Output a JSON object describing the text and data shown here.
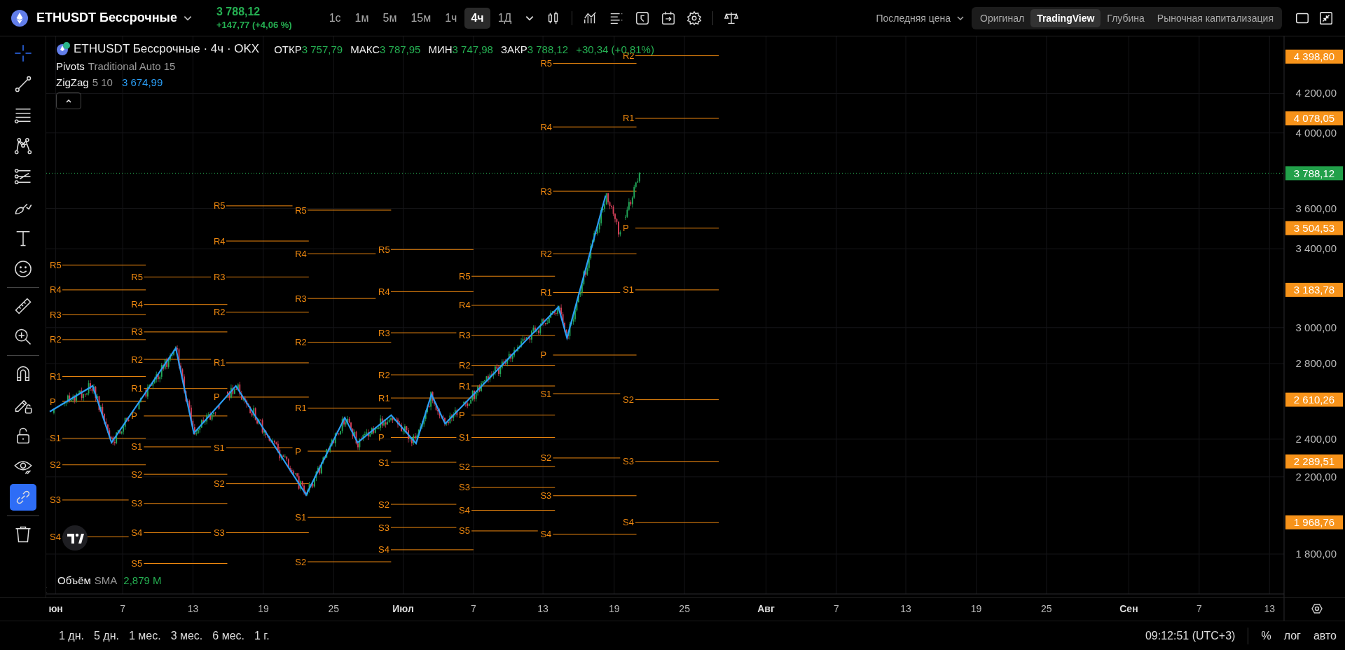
{
  "header": {
    "symbol": "ETHUSDT Бессрочные",
    "price": "3 788,12",
    "change": "+147,77 (+4,06 %)",
    "intervals": [
      {
        "label": "1с",
        "selected": false
      },
      {
        "label": "1м",
        "selected": false
      },
      {
        "label": "5м",
        "selected": false
      },
      {
        "label": "15м",
        "selected": false
      },
      {
        "label": "1ч",
        "selected": false
      },
      {
        "label": "4ч",
        "selected": true
      },
      {
        "label": "1Д",
        "selected": false
      }
    ],
    "price_source": "Последняя цена",
    "views": [
      {
        "label": "Оригинал",
        "selected": false
      },
      {
        "label": "TradingView",
        "selected": true
      },
      {
        "label": "Глубина",
        "selected": false
      },
      {
        "label": "Рыночная капитализация",
        "selected": false
      }
    ]
  },
  "tool_groups": [
    [
      {
        "kind": "crosshair",
        "selected": true,
        "on": false
      },
      {
        "kind": "line",
        "selected": false,
        "on": false
      },
      {
        "kind": "hlines",
        "selected": false,
        "on": false
      },
      {
        "kind": "pattern",
        "selected": false,
        "on": false
      },
      {
        "kind": "fib",
        "selected": false,
        "on": false
      },
      {
        "kind": "brush",
        "selected": false,
        "on": false
      },
      {
        "kind": "text",
        "selected": false,
        "on": false
      },
      {
        "kind": "smiley",
        "selected": false,
        "on": false
      }
    ],
    [
      {
        "kind": "ruler",
        "selected": false,
        "on": false
      },
      {
        "kind": "zoom",
        "selected": false,
        "on": false
      }
    ],
    [
      {
        "kind": "magnet",
        "selected": false,
        "on": false
      },
      {
        "kind": "pencil-lock",
        "selected": false,
        "on": false
      },
      {
        "kind": "lock",
        "selected": false,
        "on": false
      },
      {
        "kind": "eye",
        "selected": false,
        "on": false
      },
      {
        "kind": "link",
        "selected": false,
        "on": true
      }
    ],
    [
      {
        "kind": "trash",
        "selected": false,
        "on": false
      }
    ]
  ],
  "legend": {
    "title": "ETHUSDT Бессрочные · 4ч · OKX",
    "ohlc": [
      {
        "label": "ОТКР",
        "value": "3 757,79"
      },
      {
        "label": "МАКС",
        "value": "3 787,95"
      },
      {
        "label": "МИН",
        "value": "3 747,98"
      },
      {
        "label": "ЗАКР",
        "value": "3 788,12"
      }
    ],
    "change": "+30,34 (+0,81%)",
    "indicators": [
      {
        "name": "Pivots",
        "params": "Traditional Auto 15"
      },
      {
        "name": "ZigZag",
        "params": "5 10",
        "value": "3 674,99"
      }
    ]
  },
  "pivots": [
    {
      "labels": [
        "R5",
        "R4",
        "R3",
        "R2",
        "R1",
        "P",
        "S1",
        "S2",
        "S3",
        "S4"
      ]
    },
    {
      "labels": [
        "R5",
        "R4",
        "R3",
        "R2",
        "R1",
        "P",
        "S1",
        "S2",
        "S3",
        "S4",
        "S5"
      ]
    },
    {
      "labels": [
        "R5",
        "R4",
        "R3",
        "R2",
        "R1",
        "P",
        "S1",
        "S2",
        "S3"
      ]
    },
    {
      "labels": [
        "R5",
        "R4",
        "R3",
        "R2",
        "R1",
        "P",
        "S1",
        "S2"
      ]
    },
    {
      "labels": [
        "R5",
        "R4",
        "R3",
        "R2",
        "R1",
        "P",
        "S1",
        "S2",
        "S3",
        "S4"
      ]
    },
    {
      "labels": [
        "R5",
        "R4",
        "R3",
        "R2",
        "R1",
        "P",
        "S1",
        "S2",
        "S3",
        "S4",
        "S5"
      ]
    },
    {
      "labels": [
        "R5",
        "R4",
        "R3",
        "R2",
        "R1",
        "P",
        "S1",
        "S2",
        "S3",
        "S4"
      ]
    },
    {
      "labels": [
        "R2",
        "R1",
        "P",
        "S1",
        "S2",
        "S3",
        "S4"
      ]
    }
  ],
  "price_axis": {
    "ticks": [
      "4 200,00",
      "4 000,00",
      "3 600,00",
      "3 400,00",
      "3 000,00",
      "2 800,00",
      "2 400,00",
      "2 200,00",
      "1 800,00"
    ],
    "badges": [
      {
        "text": "4 398,80",
        "kind": "level"
      },
      {
        "text": "4 078,05",
        "kind": "level"
      },
      {
        "text": "3 788,12",
        "kind": "last"
      },
      {
        "text": "3 504,53",
        "kind": "level"
      },
      {
        "text": "3 183,78",
        "kind": "level"
      },
      {
        "text": "2 610,26",
        "kind": "level"
      },
      {
        "text": "2 289,51",
        "kind": "level"
      },
      {
        "text": "1 968,76",
        "kind": "level"
      }
    ]
  },
  "volume": {
    "name": "Объём",
    "ma": "SMA",
    "value": "2,879 M"
  },
  "time_axis": [
    {
      "label": "юн",
      "kind": "month"
    },
    {
      "label": "7",
      "kind": "day"
    },
    {
      "label": "13",
      "kind": "day"
    },
    {
      "label": "19",
      "kind": "day"
    },
    {
      "label": "25",
      "kind": "day"
    },
    {
      "label": "Июл",
      "kind": "month"
    },
    {
      "label": "7",
      "kind": "day"
    },
    {
      "label": "13",
      "kind": "day"
    },
    {
      "label": "19",
      "kind": "day"
    },
    {
      "label": "25",
      "kind": "day"
    },
    {
      "label": "Авг",
      "kind": "month"
    },
    {
      "label": "7",
      "kind": "day"
    },
    {
      "label": "13",
      "kind": "day"
    },
    {
      "label": "19",
      "kind": "day"
    },
    {
      "label": "25",
      "kind": "day"
    },
    {
      "label": "Сен",
      "kind": "month"
    },
    {
      "label": "7",
      "kind": "day"
    },
    {
      "label": "13",
      "kind": "day"
    }
  ],
  "ranges": [
    "1 дн.",
    "5 дн.",
    "1 мес.",
    "3 мес.",
    "6 мес.",
    "1 г."
  ],
  "clock": "09:12:51 (UTC+3)",
  "scale_buttons": [
    "%",
    "лог",
    "авто"
  ]
}
